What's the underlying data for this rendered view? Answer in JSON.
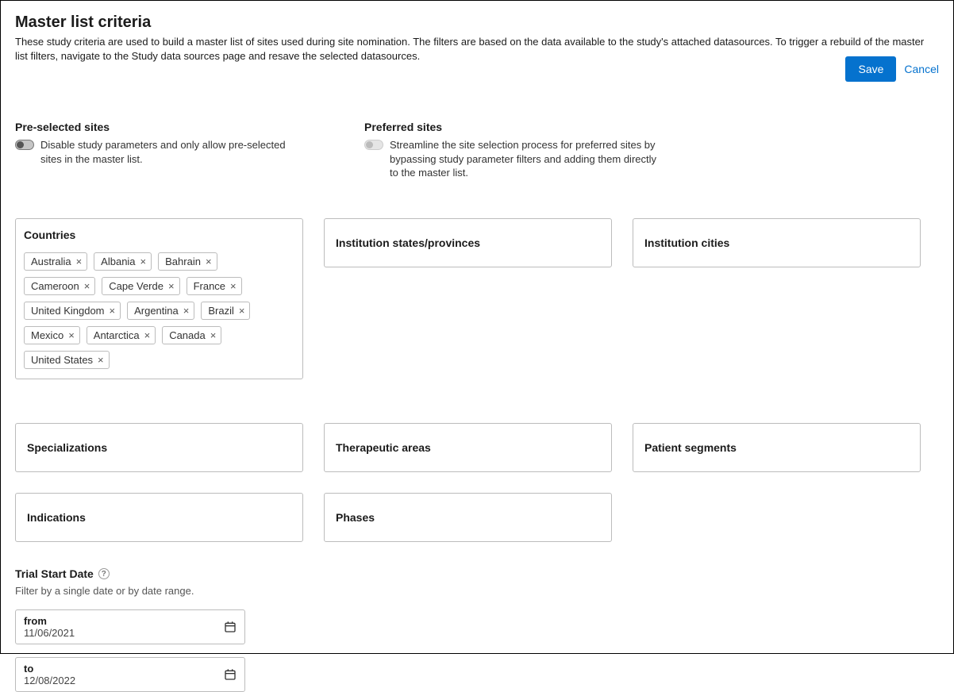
{
  "header": {
    "title": "Master list criteria",
    "description": "These study criteria are used to build a master list of sites used during site nomination. The filters are based on the data available to the study's attached datasources. To trigger a rebuild of the master list filters, navigate to the Study data sources page and resave the selected datasources."
  },
  "actions": {
    "save_label": "Save",
    "cancel_label": "Cancel"
  },
  "toggles": {
    "preselected": {
      "heading": "Pre-selected sites",
      "description": "Disable study parameters and only allow pre-selected sites in the master list."
    },
    "preferred": {
      "heading": "Preferred sites",
      "description": "Streamline the site selection process for preferred sites by bypassing study parameter filters and adding them directly to the master list."
    }
  },
  "filters": {
    "countries": {
      "label": "Countries",
      "chips": [
        "Australia",
        "Albania",
        "Bahrain",
        "Cameroon",
        "Cape Verde",
        "France",
        "United Kingdom",
        "Argentina",
        "Brazil",
        "Mexico",
        "Antarctica",
        "Canada",
        "United States"
      ]
    },
    "states": {
      "label": "Institution states/provinces"
    },
    "cities": {
      "label": "Institution cities"
    },
    "specializations": {
      "label": "Specializations"
    },
    "therapeutic_areas": {
      "label": "Therapeutic areas"
    },
    "patient_segments": {
      "label": "Patient segments"
    },
    "indications": {
      "label": "Indications"
    },
    "phases": {
      "label": "Phases"
    }
  },
  "trial_date": {
    "heading": "Trial Start Date",
    "subtext": "Filter by a single date or by date range.",
    "from_label": "from",
    "from_value": "11/06/2021",
    "to_label": "to",
    "to_value": "12/08/2022"
  }
}
